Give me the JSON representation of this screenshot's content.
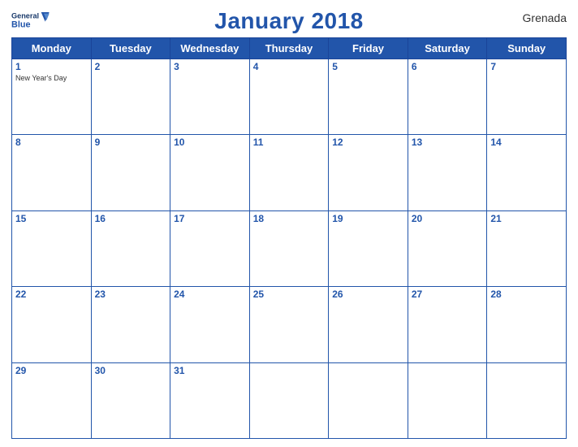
{
  "header": {
    "logo_line1": "General",
    "logo_line2": "Blue",
    "title": "January 2018",
    "country": "Grenada"
  },
  "days_of_week": [
    "Monday",
    "Tuesday",
    "Wednesday",
    "Thursday",
    "Friday",
    "Saturday",
    "Sunday"
  ],
  "weeks": [
    [
      {
        "day": "1",
        "holiday": "New Year's Day"
      },
      {
        "day": "2",
        "holiday": ""
      },
      {
        "day": "3",
        "holiday": ""
      },
      {
        "day": "4",
        "holiday": ""
      },
      {
        "day": "5",
        "holiday": ""
      },
      {
        "day": "6",
        "holiday": ""
      },
      {
        "day": "7",
        "holiday": ""
      }
    ],
    [
      {
        "day": "8",
        "holiday": ""
      },
      {
        "day": "9",
        "holiday": ""
      },
      {
        "day": "10",
        "holiday": ""
      },
      {
        "day": "11",
        "holiday": ""
      },
      {
        "day": "12",
        "holiday": ""
      },
      {
        "day": "13",
        "holiday": ""
      },
      {
        "day": "14",
        "holiday": ""
      }
    ],
    [
      {
        "day": "15",
        "holiday": ""
      },
      {
        "day": "16",
        "holiday": ""
      },
      {
        "day": "17",
        "holiday": ""
      },
      {
        "day": "18",
        "holiday": ""
      },
      {
        "day": "19",
        "holiday": ""
      },
      {
        "day": "20",
        "holiday": ""
      },
      {
        "day": "21",
        "holiday": ""
      }
    ],
    [
      {
        "day": "22",
        "holiday": ""
      },
      {
        "day": "23",
        "holiday": ""
      },
      {
        "day": "24",
        "holiday": ""
      },
      {
        "day": "25",
        "holiday": ""
      },
      {
        "day": "26",
        "holiday": ""
      },
      {
        "day": "27",
        "holiday": ""
      },
      {
        "day": "28",
        "holiday": ""
      }
    ],
    [
      {
        "day": "29",
        "holiday": ""
      },
      {
        "day": "30",
        "holiday": ""
      },
      {
        "day": "31",
        "holiday": ""
      },
      {
        "day": "",
        "holiday": ""
      },
      {
        "day": "",
        "holiday": ""
      },
      {
        "day": "",
        "holiday": ""
      },
      {
        "day": "",
        "holiday": ""
      }
    ]
  ]
}
